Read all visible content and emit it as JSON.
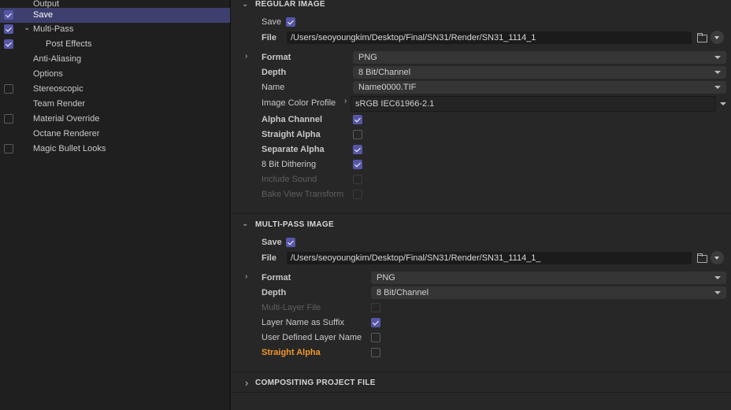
{
  "sidebar": {
    "items": [
      {
        "label": "Output",
        "checkbox": null
      },
      {
        "label": "Save",
        "checkbox": true,
        "selected": true
      },
      {
        "label": "Multi-Pass",
        "checkbox": true,
        "expanded": true
      },
      {
        "label": "Post Effects",
        "checkbox": true
      },
      {
        "label": "Anti-Aliasing",
        "checkbox": null
      },
      {
        "label": "Options",
        "checkbox": null
      },
      {
        "label": "Stereoscopic",
        "checkbox": false
      },
      {
        "label": "Team Render",
        "checkbox": null
      },
      {
        "label": "Material Override",
        "checkbox": false
      },
      {
        "label": "Octane Renderer",
        "checkbox": null
      },
      {
        "label": "Magic Bullet Looks",
        "checkbox": false
      }
    ]
  },
  "regular": {
    "title": "REGULAR IMAGE",
    "save_label": "Save",
    "save": true,
    "file_label": "File",
    "file_value": "/Users/seoyoungkim/Desktop/Final/SN31/Render/SN31_1114_1",
    "format_label": "Format",
    "format_value": "PNG",
    "depth_label": "Depth",
    "depth_value": "8 Bit/Channel",
    "name_label": "Name",
    "name_value": "Name0000.TIF",
    "profile_label": "Image Color Profile",
    "profile_value": "sRGB IEC61966-2.1",
    "options": [
      {
        "label": "Alpha Channel",
        "checked": true
      },
      {
        "label": "Straight Alpha",
        "checked": false
      },
      {
        "label": "Separate Alpha",
        "checked": true
      },
      {
        "label": "8 Bit Dithering",
        "checked": true
      },
      {
        "label": "Include Sound",
        "checked": false,
        "disabled": true
      },
      {
        "label": "Bake View Transform",
        "checked": false,
        "disabled": true
      }
    ]
  },
  "multipass": {
    "title": "MULTI-PASS IMAGE",
    "save_label": "Save",
    "save": true,
    "file_label": "File",
    "file_value": "/Users/seoyoungkim/Desktop/Final/SN31/Render/SN31_1114_1_",
    "format_label": "Format",
    "format_value": "PNG",
    "depth_label": "Depth",
    "depth_value": "8 Bit/Channel",
    "options": [
      {
        "label": "Multi-Layer File",
        "checked": false,
        "disabled": true
      },
      {
        "label": "Layer Name as Suffix",
        "checked": true
      },
      {
        "label": "User Defined Layer Name",
        "checked": false
      },
      {
        "label": "Straight Alpha",
        "checked": false,
        "highlight": "#f0962e"
      }
    ]
  },
  "compositing": {
    "title": "COMPOSITING PROJECT FILE"
  },
  "colors": {
    "accent": "#5756a6",
    "selection": "#3d3f6e",
    "warning": "#f0962e"
  }
}
